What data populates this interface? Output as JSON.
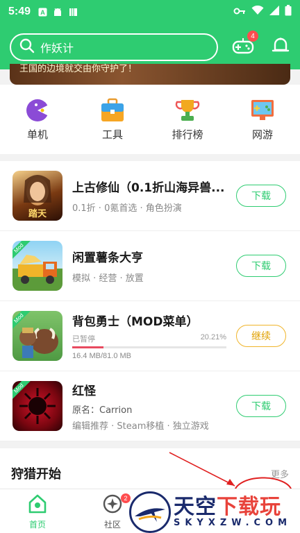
{
  "status_bar": {
    "time": "5:49"
  },
  "header": {
    "search_placeholder": "作妖计",
    "gamepad_badge": "4"
  },
  "banner": {
    "text": "王国的边境就交由你守护了！"
  },
  "categories": [
    {
      "label": "单机",
      "icon": "pacman-icon"
    },
    {
      "label": "工具",
      "icon": "toolbox-icon"
    },
    {
      "label": "排行榜",
      "icon": "trophy-icon"
    },
    {
      "label": "网游",
      "icon": "gamepad-screen-icon"
    }
  ],
  "games": [
    {
      "name": "上古修仙（0.1折山海异兽...",
      "sub": "0.1折 · 0氪首选 · 角色扮演",
      "button": "下载"
    },
    {
      "name": "闲置薯条大亨",
      "tag": "Mod",
      "sub": "模拟 · 经营 · 放置",
      "button": "下载"
    },
    {
      "name": "背包勇士（MOD菜单）",
      "tag": "Mod",
      "status": "已暂停",
      "progress": "20.21%",
      "progress_value": 0.2021,
      "size": "16.4 MB/81.0 MB",
      "button": "继续"
    },
    {
      "name": "红怪",
      "tag": "Mod",
      "orig": "原名：Carrion",
      "sub": "编辑推荐 · Steam移植 · 独立游戏",
      "button": "下载"
    }
  ],
  "section": {
    "title": "狩猎开始",
    "more": "更多"
  },
  "nav": {
    "home": "首页",
    "community": "社区",
    "community_badge": "2"
  },
  "watermark": {
    "main_a": "天空",
    "main_b": "下载玩",
    "sub": "SKYXZW.COM"
  },
  "colors": {
    "primary": "#2ecc71",
    "continue": "#f0b429",
    "badge": "#ff4d4f"
  }
}
